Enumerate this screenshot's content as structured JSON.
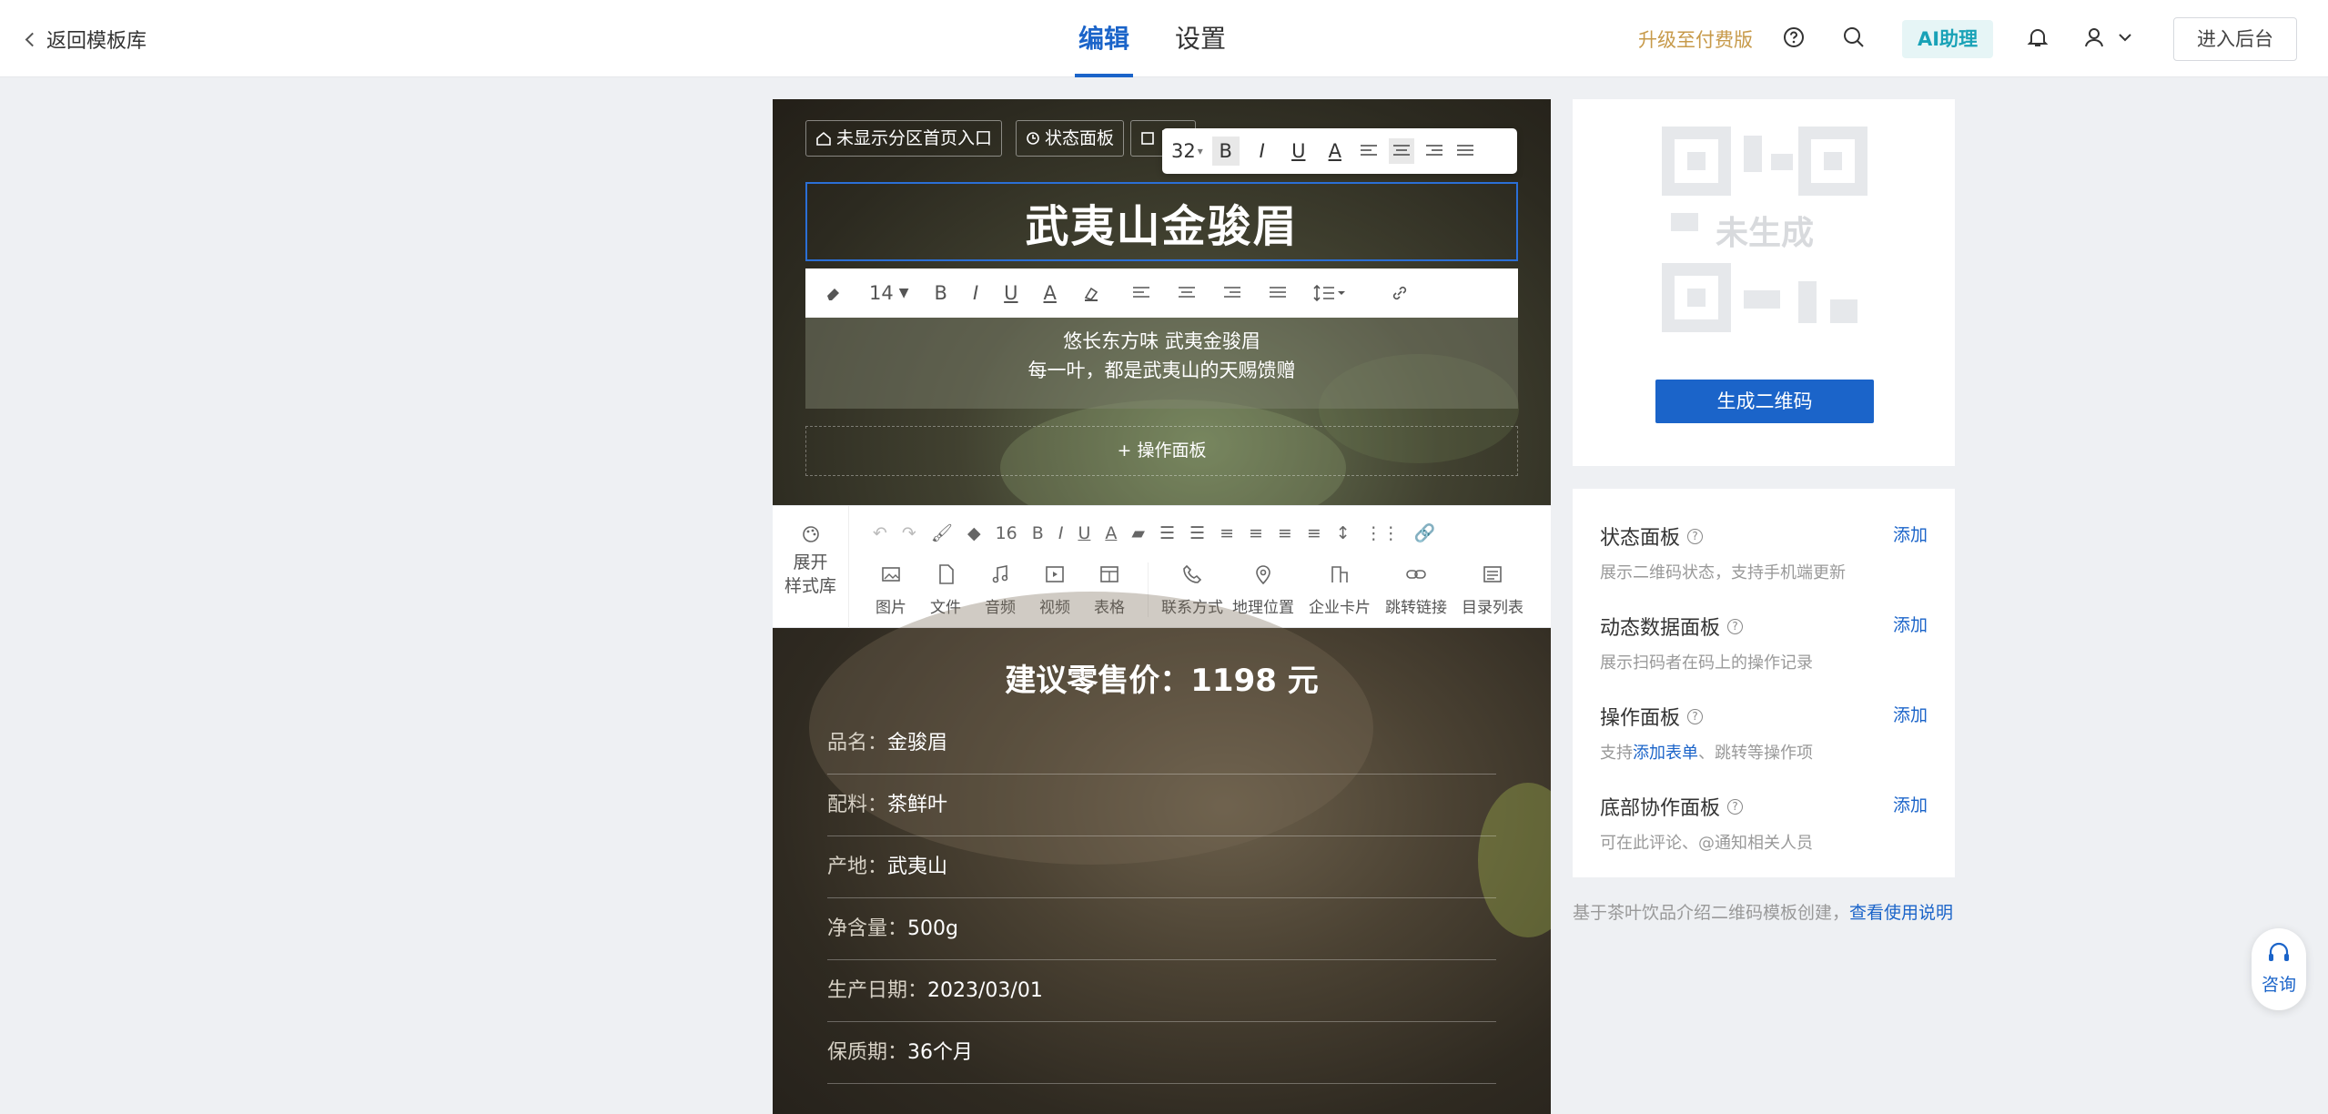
{
  "topbar": {
    "back_label": "返回模板库",
    "tabs": [
      {
        "label": "编辑",
        "active": true
      },
      {
        "label": "设置",
        "active": false
      }
    ],
    "upgrade_label": "升级至付费版",
    "ai_label": "AI助理",
    "backend_label": "进入后台",
    "icons": [
      "help-icon",
      "search-icon",
      "bell-icon",
      "user-icon",
      "chevron-down-icon"
    ]
  },
  "hero": {
    "pills": [
      "未显示分区首页入口",
      "状态面板",
      "目"
    ],
    "format_bar": {
      "font_size": "32",
      "buttons": [
        "B",
        "I",
        "U",
        "A"
      ]
    },
    "title": "武夷山金骏眉",
    "richtext_bar": {
      "font_size": "14"
    },
    "subtitle_line1": "悠长东方味 武夷金骏眉",
    "subtitle_line2": "每一叶，都是武夷山的天赐馈赠",
    "op_panel_label": "+ 操作面板"
  },
  "editor_toolbar": {
    "stylelib_line1": "展开",
    "stylelib_line2": "样式库",
    "font_size": "16",
    "tools": [
      "图片",
      "文件",
      "音频",
      "视频",
      "表格",
      "联系方式",
      "地理位置",
      "企业卡片",
      "跳转链接",
      "目录列表"
    ]
  },
  "product": {
    "price_label": "建议零售价：1198 元",
    "specs": [
      {
        "key": "品名：",
        "value": "金骏眉"
      },
      {
        "key": "配料：",
        "value": "茶鲜叶"
      },
      {
        "key": "产地：",
        "value": "武夷山"
      },
      {
        "key": "净含量：",
        "value": "500g"
      },
      {
        "key": "生产日期：",
        "value": "2023/03/01"
      },
      {
        "key": "保质期：",
        "value": "36个月"
      }
    ]
  },
  "qr": {
    "placeholder_text": "未生成",
    "generate_label": "生成二维码"
  },
  "panels": {
    "add_label": "添加",
    "items": [
      {
        "title": "状态面板",
        "desc": "展示二维码状态，支持手机端更新"
      },
      {
        "title": "动态数据面板",
        "desc": "展示扫码者在码上的操作记录"
      },
      {
        "title": "操作面板",
        "desc_prefix": "支持",
        "desc_link": "添加表单",
        "desc_suffix": "、跳转等操作项"
      },
      {
        "title": "底部协作面板",
        "desc": "可在此评论、@通知相关人员"
      }
    ]
  },
  "footnote": {
    "text": "基于茶叶饮品介绍二维码模板创建，",
    "link": "查看使用说明"
  },
  "consult_label": "咨询",
  "colors": {
    "accent": "#1b64c9",
    "upgrade": "#c79a4a",
    "ai": "#19a2b7"
  }
}
